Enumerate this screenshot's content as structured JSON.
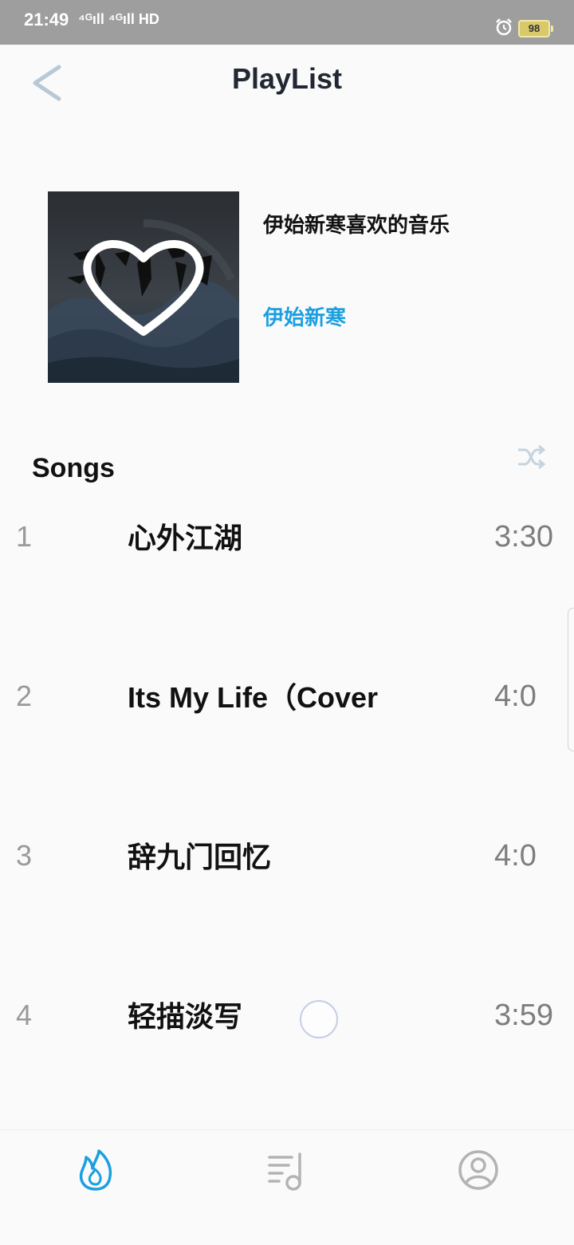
{
  "status_bar": {
    "time": "21:49",
    "signal_text": "⁴ᴳıll ⁴ᴳıll HD",
    "battery": "98",
    "icons": [
      "alarm-icon",
      "battery-icon"
    ]
  },
  "header": {
    "title": "PlayList",
    "back_icon": "back-arrow-icon"
  },
  "playlist": {
    "cover_icon": "heart-icon",
    "cover_art_text": "心外江湖",
    "name": "伊始新寒喜欢的音乐",
    "owner": "伊始新寒"
  },
  "songs_section": {
    "heading": "Songs",
    "shuffle_icon": "shuffle-icon",
    "items": [
      {
        "index": "1",
        "title": "心外江湖",
        "duration": "3:30"
      },
      {
        "index": "2",
        "title": "Its My Life（Cover",
        "duration": "4:0"
      },
      {
        "index": "3",
        "title": "辞九门回忆",
        "duration": "4:0"
      },
      {
        "index": "4",
        "title": "轻描淡写",
        "duration": "3:59"
      }
    ]
  },
  "tab_bar": {
    "items": [
      {
        "icon": "flame-icon",
        "active": true
      },
      {
        "icon": "music-list-icon",
        "active": false
      },
      {
        "icon": "user-profile-icon",
        "active": false
      }
    ]
  },
  "colors": {
    "accent": "#1a9fe0",
    "title_text": "#222833",
    "secondary_text": "#7d7d7d",
    "inactive_icon": "#b3b3b3",
    "status_bar": "#9e9e9e"
  }
}
